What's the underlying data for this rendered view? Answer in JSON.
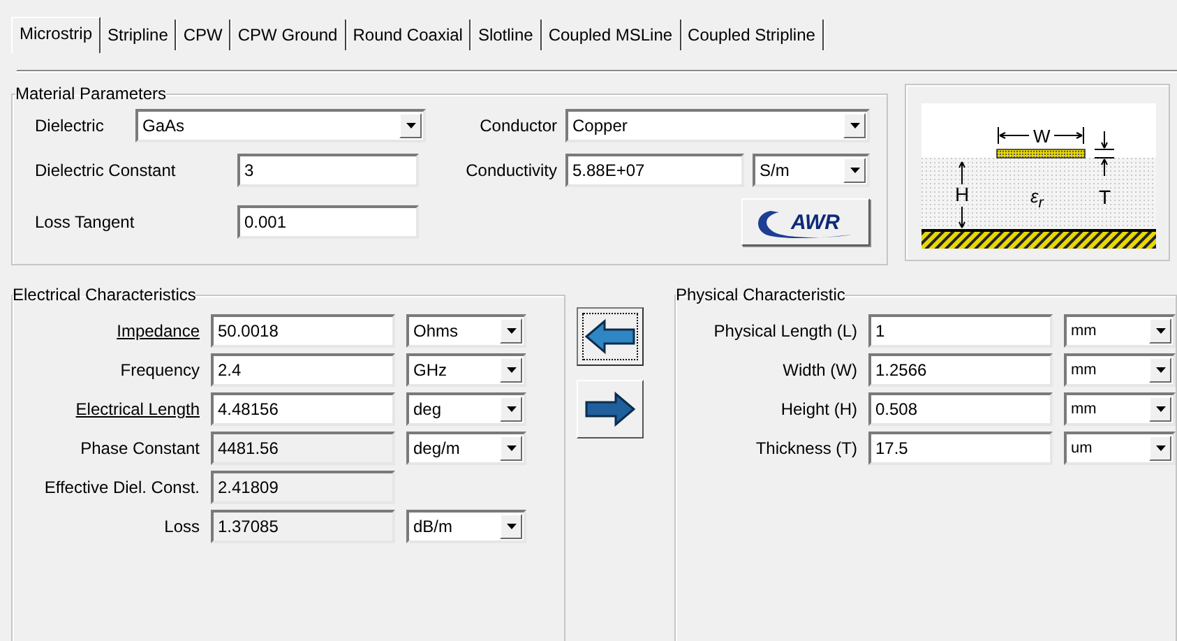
{
  "tabs": [
    {
      "label": "Microstrip",
      "selected": true
    },
    {
      "label": "Stripline",
      "selected": false
    },
    {
      "label": "CPW",
      "selected": false
    },
    {
      "label": "CPW Ground",
      "selected": false
    },
    {
      "label": "Round Coaxial",
      "selected": false
    },
    {
      "label": "Slotline",
      "selected": false
    },
    {
      "label": "Coupled MSLine",
      "selected": false
    },
    {
      "label": "Coupled Stripline",
      "selected": false
    }
  ],
  "material": {
    "title": "Material Parameters",
    "dielectric": {
      "label": "Dielectric",
      "value": "GaAs"
    },
    "dielectric_constant": {
      "label": "Dielectric Constant",
      "value": "3"
    },
    "loss_tangent": {
      "label": "Loss Tangent",
      "value": "0.001"
    },
    "conductor": {
      "label": "Conductor",
      "value": "Copper"
    },
    "conductivity": {
      "label": "Conductivity",
      "value": "5.88E+07",
      "unit": "S/m"
    },
    "logo_button": {
      "label": "AWR"
    }
  },
  "diagram": {
    "width_label": "W",
    "height_label": "H",
    "thickness_label": "T",
    "permittivity_label": "ε$_{r}$"
  },
  "electrical": {
    "title": "Electrical Characteristics",
    "rows": [
      {
        "label": "Impedance",
        "value": "50.0018",
        "unit": "Ohms",
        "underlined": true,
        "readonly": false
      },
      {
        "label": "Frequency",
        "value": "2.4",
        "unit": "GHz",
        "underlined": false,
        "readonly": false
      },
      {
        "label": "Electrical Length",
        "value": "4.48156",
        "unit": "deg",
        "underlined": true,
        "readonly": false
      },
      {
        "label": "Phase Constant",
        "value": "4481.56",
        "unit": "deg/m",
        "underlined": false,
        "readonly": true
      },
      {
        "label": "Effective Diel. Const.",
        "value": "2.41809",
        "underlined": false,
        "readonly": true
      },
      {
        "label": "Loss",
        "value": "1.37085",
        "unit": "dB/m",
        "underlined": false,
        "readonly": true
      }
    ]
  },
  "arrows": [
    {
      "kind": "left",
      "focused": true
    },
    {
      "kind": "right",
      "focused": false
    }
  ],
  "physical": {
    "title": "Physical Characteristic",
    "rows": [
      {
        "label": "Physical Length (L)",
        "value": "1",
        "unit": "mm"
      },
      {
        "label": "Width (W)",
        "value": "1.2566",
        "unit": "mm"
      },
      {
        "label": "Height (H)",
        "value": "0.508",
        "unit": "mm"
      },
      {
        "label": "Thickness (T)",
        "value": "17.5",
        "unit": "um"
      }
    ]
  }
}
